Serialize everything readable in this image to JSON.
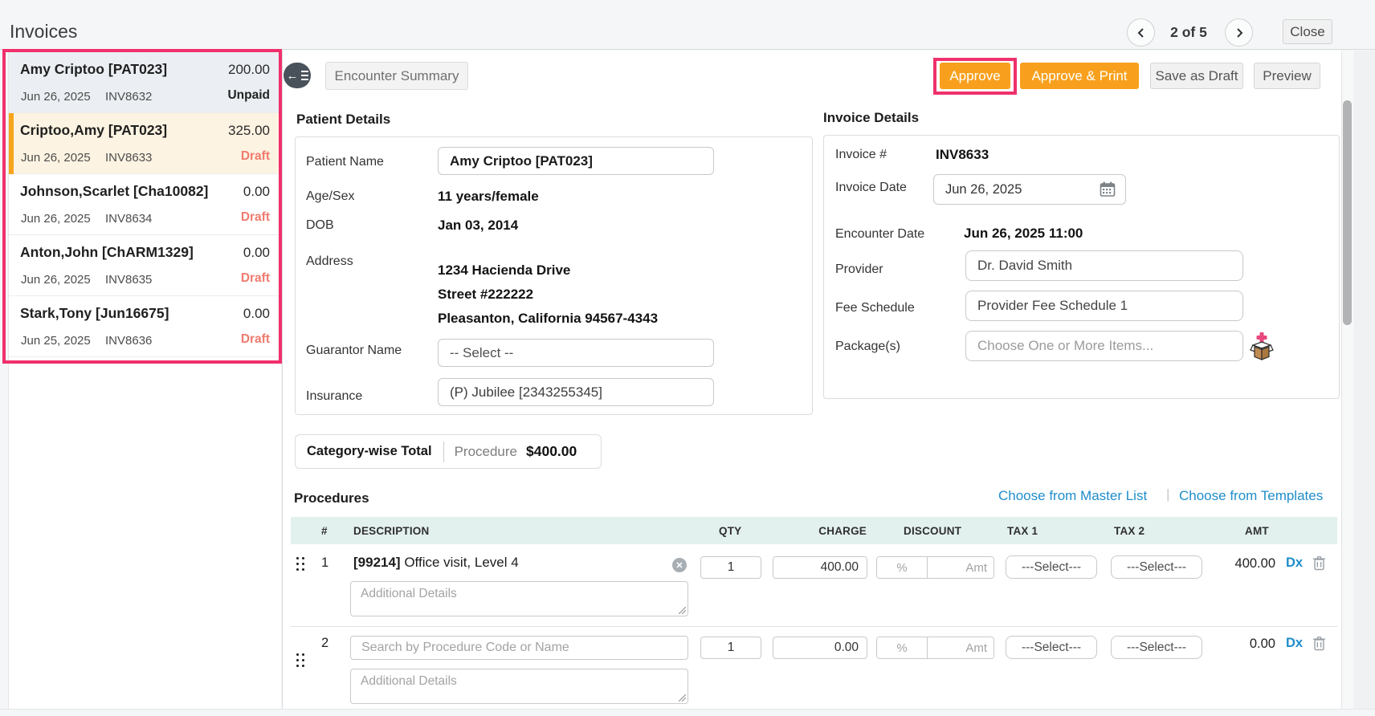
{
  "page_title": "Invoices",
  "pagination": {
    "count": "2 of 5",
    "close_label": "Close"
  },
  "sidebar": {
    "items": [
      {
        "name": "Amy Criptoo [PAT023]",
        "amount": "200.00",
        "date": "Jun 26, 2025",
        "invoice": "INV8632",
        "status": "Unpaid"
      },
      {
        "name": "Criptoo,Amy [PAT023]",
        "amount": "325.00",
        "date": "Jun 26, 2025",
        "invoice": "INV8633",
        "status": "Draft"
      },
      {
        "name": "Johnson,Scarlet [Cha10082]",
        "amount": "0.00",
        "date": "Jun 26, 2025",
        "invoice": "INV8634",
        "status": "Draft"
      },
      {
        "name": "Anton,John [ChARM1329]",
        "amount": "0.00",
        "date": "Jun 26, 2025",
        "invoice": "INV8635",
        "status": "Draft"
      },
      {
        "name": "Stark,Tony [Jun16675]",
        "amount": "0.00",
        "date": "Jun 25, 2025",
        "invoice": "INV8636",
        "status": "Draft"
      }
    ]
  },
  "toolbar": {
    "encounter_summary": "Encounter Summary",
    "approve": "Approve",
    "approve_print": "Approve & Print",
    "save_draft": "Save as Draft",
    "preview": "Preview"
  },
  "patient": {
    "heading": "Patient Details",
    "labels": {
      "name": "Patient Name",
      "age_sex": "Age/Sex",
      "dob": "DOB",
      "address": "Address",
      "guarantor": "Guarantor Name",
      "insurance": "Insurance"
    },
    "name": "Amy Criptoo [PAT023]",
    "age_sex": "11 years/female",
    "dob": "Jan 03, 2014",
    "address_line1": "1234 Hacienda Drive",
    "address_line2": "Street #222222",
    "address_line3": "Pleasanton, California 94567-4343",
    "guarantor": "-- Select --",
    "insurance": "(P) Jubilee [2343255345]"
  },
  "invoice": {
    "heading": "Invoice Details",
    "labels": {
      "number": "Invoice #",
      "date": "Invoice Date",
      "encounter_date": "Encounter Date",
      "provider": "Provider",
      "fee_schedule": "Fee Schedule",
      "packages": "Package(s)"
    },
    "number": "INV8633",
    "date": "Jun 26, 2025",
    "encounter_date": "Jun 26, 2025 11:00",
    "provider": "Dr. David Smith",
    "fee_schedule": "Provider Fee Schedule 1",
    "packages_placeholder": "Choose One or More Items..."
  },
  "category_total": {
    "label": "Category-wise Total",
    "category": "Procedure",
    "amount": "$400.00"
  },
  "procedures": {
    "heading": "Procedures",
    "link_master": "Choose from Master List",
    "link_templates": "Choose from Templates",
    "columns": [
      "#",
      "DESCRIPTION",
      "QTY",
      "CHARGE",
      "DISCOUNT",
      "TAX 1",
      "TAX 2",
      "AMT"
    ],
    "rows": [
      {
        "num": "1",
        "code": "[99214]",
        "desc": " Office visit, Level 4",
        "qty": "1",
        "charge": "400.00",
        "pct_placeholder": "%",
        "amt_placeholder": "Amt",
        "tax1": "---Select---",
        "tax2": "---Select---",
        "amt": "400.00",
        "dx": "Dx",
        "details_placeholder": "Additional Details"
      },
      {
        "num": "2",
        "search_placeholder": "Search by Procedure Code or Name",
        "qty": "1",
        "charge": "0.00",
        "pct_placeholder": "%",
        "amt_placeholder": "Amt",
        "tax1": "---Select---",
        "tax2": "---Select---",
        "amt": "0.00",
        "dx": "Dx",
        "details_placeholder": "Additional Details"
      }
    ]
  },
  "icons": {
    "collapse": "collapse-sidebar-icon",
    "prev": "chevron-left-icon",
    "next": "chevron-right-icon",
    "calendar": "calendar-icon",
    "package": "package-add-icon",
    "remove": "close-circle-icon",
    "drag": "drag-handle-icon",
    "trash": "trash-icon",
    "resize": "resize-handle-icon"
  },
  "colors": {
    "accent_orange": "#f8a01d",
    "annotation_pink": "#f0306c",
    "link_blue": "#1f8dca",
    "draft_red": "#ef7b6e",
    "selected_bg": "#fdf3e2",
    "hover_bg": "#ebeff3",
    "table_header_bg": "#e3f1ee"
  }
}
